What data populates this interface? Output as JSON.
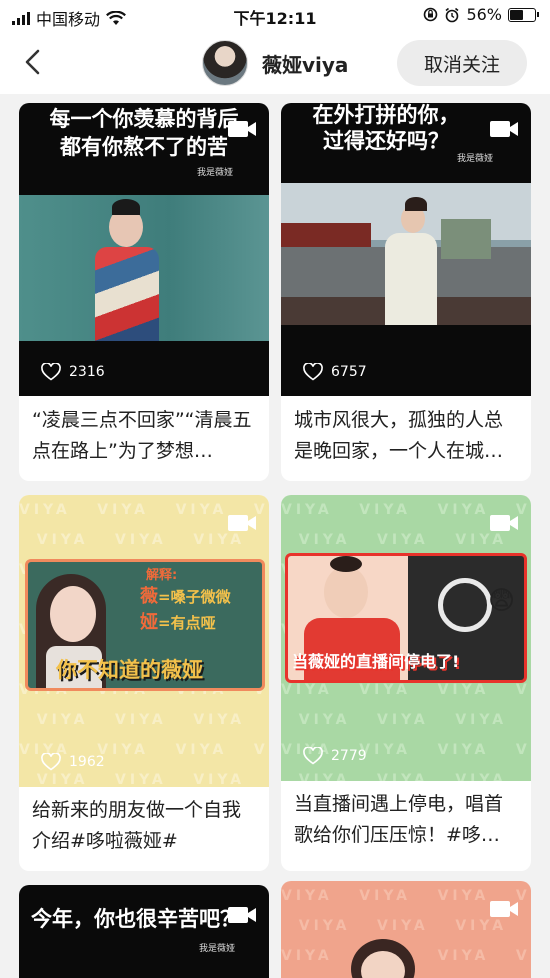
{
  "status_bar": {
    "carrier": "中国移动",
    "time": "下午12:11",
    "battery": "56%",
    "battery_level": 0.56
  },
  "header": {
    "back_icon": "chevron-left-icon",
    "title": "薇娅viya",
    "unfollow_label": "取消关注"
  },
  "cards": [
    {
      "overlay_line1": "每一个你羡慕的背后",
      "overlay_line2": "都有你熬不了的苦",
      "signature": "我是薇娅",
      "likes": "2316",
      "caption": "“凌晨三点不回家”“清晨五点在路上”为了梦想…"
    },
    {
      "overlay_line1": "在外打拼的你，",
      "overlay_line2": "过得还好吗？",
      "signature": "我是薇娅",
      "likes": "6757",
      "caption": "城市风很大，孤独的人总是晚回家，一个人在城…"
    },
    {
      "pattern_word": "VIYA",
      "explain_label": "解释:",
      "line_a_left": "薇",
      "line_a_right": "=嗓子微微",
      "line_b_left": "娅",
      "line_b_right": "=有点哑",
      "banner_title": "你不知道的薇娅",
      "likes": "1962",
      "caption": "给新来的朋友做一个自我介绍#哆啦薇娅#"
    },
    {
      "pattern_word": "VIYA",
      "banner_title": "当薇娅的直播间停电了!",
      "likes": "2779",
      "caption": "当直播间遇上停电，唱首歌给你们压压惊！#哆…"
    },
    {
      "overlay_line1": "今年，你也很辛苦吧？",
      "signature": "我是薇娅"
    },
    {
      "pattern_word": "VIYA"
    }
  ],
  "colors": {
    "accent_red": "#e8332b",
    "card_bg": "#ffffff",
    "page_bg": "#f2f2f2",
    "button_bg": "#ececec",
    "yellow_bg": "#f3e6a6",
    "green_bg": "#a9d8a4",
    "salmon_bg": "#f0a48c"
  }
}
